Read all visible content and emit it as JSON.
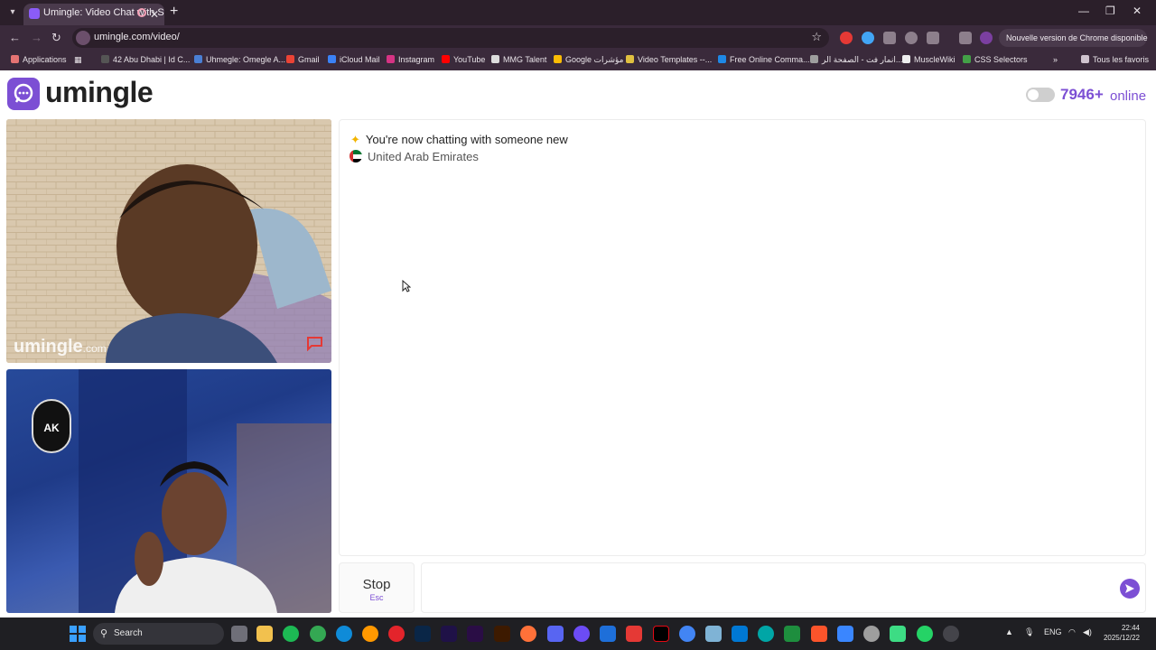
{
  "browser": {
    "tab_title": "Umingle: Video Chat with St",
    "url": "umingle.com/video/",
    "update_label": "Nouvelle version de Chrome disponible",
    "bookmarks": [
      {
        "label": "Applications",
        "color": "#e57373"
      },
      {
        "label": "42 Abu Dhabi | Id C...",
        "color": "#555555"
      },
      {
        "label": "Uhmegle: Omegle A...",
        "color": "#4a7fd4"
      },
      {
        "label": "Gmail",
        "color": "#ea4335"
      },
      {
        "label": "iCloud Mail",
        "color": "#3b82f6"
      },
      {
        "label": "Instagram",
        "color": "#d63384"
      },
      {
        "label": "YouTube",
        "color": "#ff0000"
      },
      {
        "label": "MMG Talent",
        "color": "#dddddd"
      },
      {
        "label": "Google مؤشرات",
        "color": "#fbbc05"
      },
      {
        "label": "Video Templates --...",
        "color": "#e0c040"
      },
      {
        "label": "Free Online Comma...",
        "color": "#1e88e5"
      },
      {
        "label": "انمار فت - الصفحة الر...",
        "color": "#9e9e9e"
      },
      {
        "label": "MuscleWiki",
        "color": "#eeeeee"
      },
      {
        "label": "CSS Selectors",
        "color": "#43a047"
      }
    ],
    "all_bookmarks_label": "Tous les favoris"
  },
  "site": {
    "logo_text": "umingle",
    "online_count": "7946+",
    "online_label": "online",
    "accent_color": "#7c4fd4"
  },
  "video": {
    "watermark_main": "umingle",
    "watermark_domain": ".com",
    "local_badge": "AK"
  },
  "chat": {
    "system_message": "You're now chatting with someone new",
    "country": "United Arab Emirates",
    "stop_label": "Stop",
    "stop_shortcut": "Esc",
    "message_placeholder": "",
    "message_value": ""
  },
  "taskbar": {
    "search_label": "Search",
    "language": "ENG",
    "time": "22:44",
    "date": "2025/12/22"
  }
}
